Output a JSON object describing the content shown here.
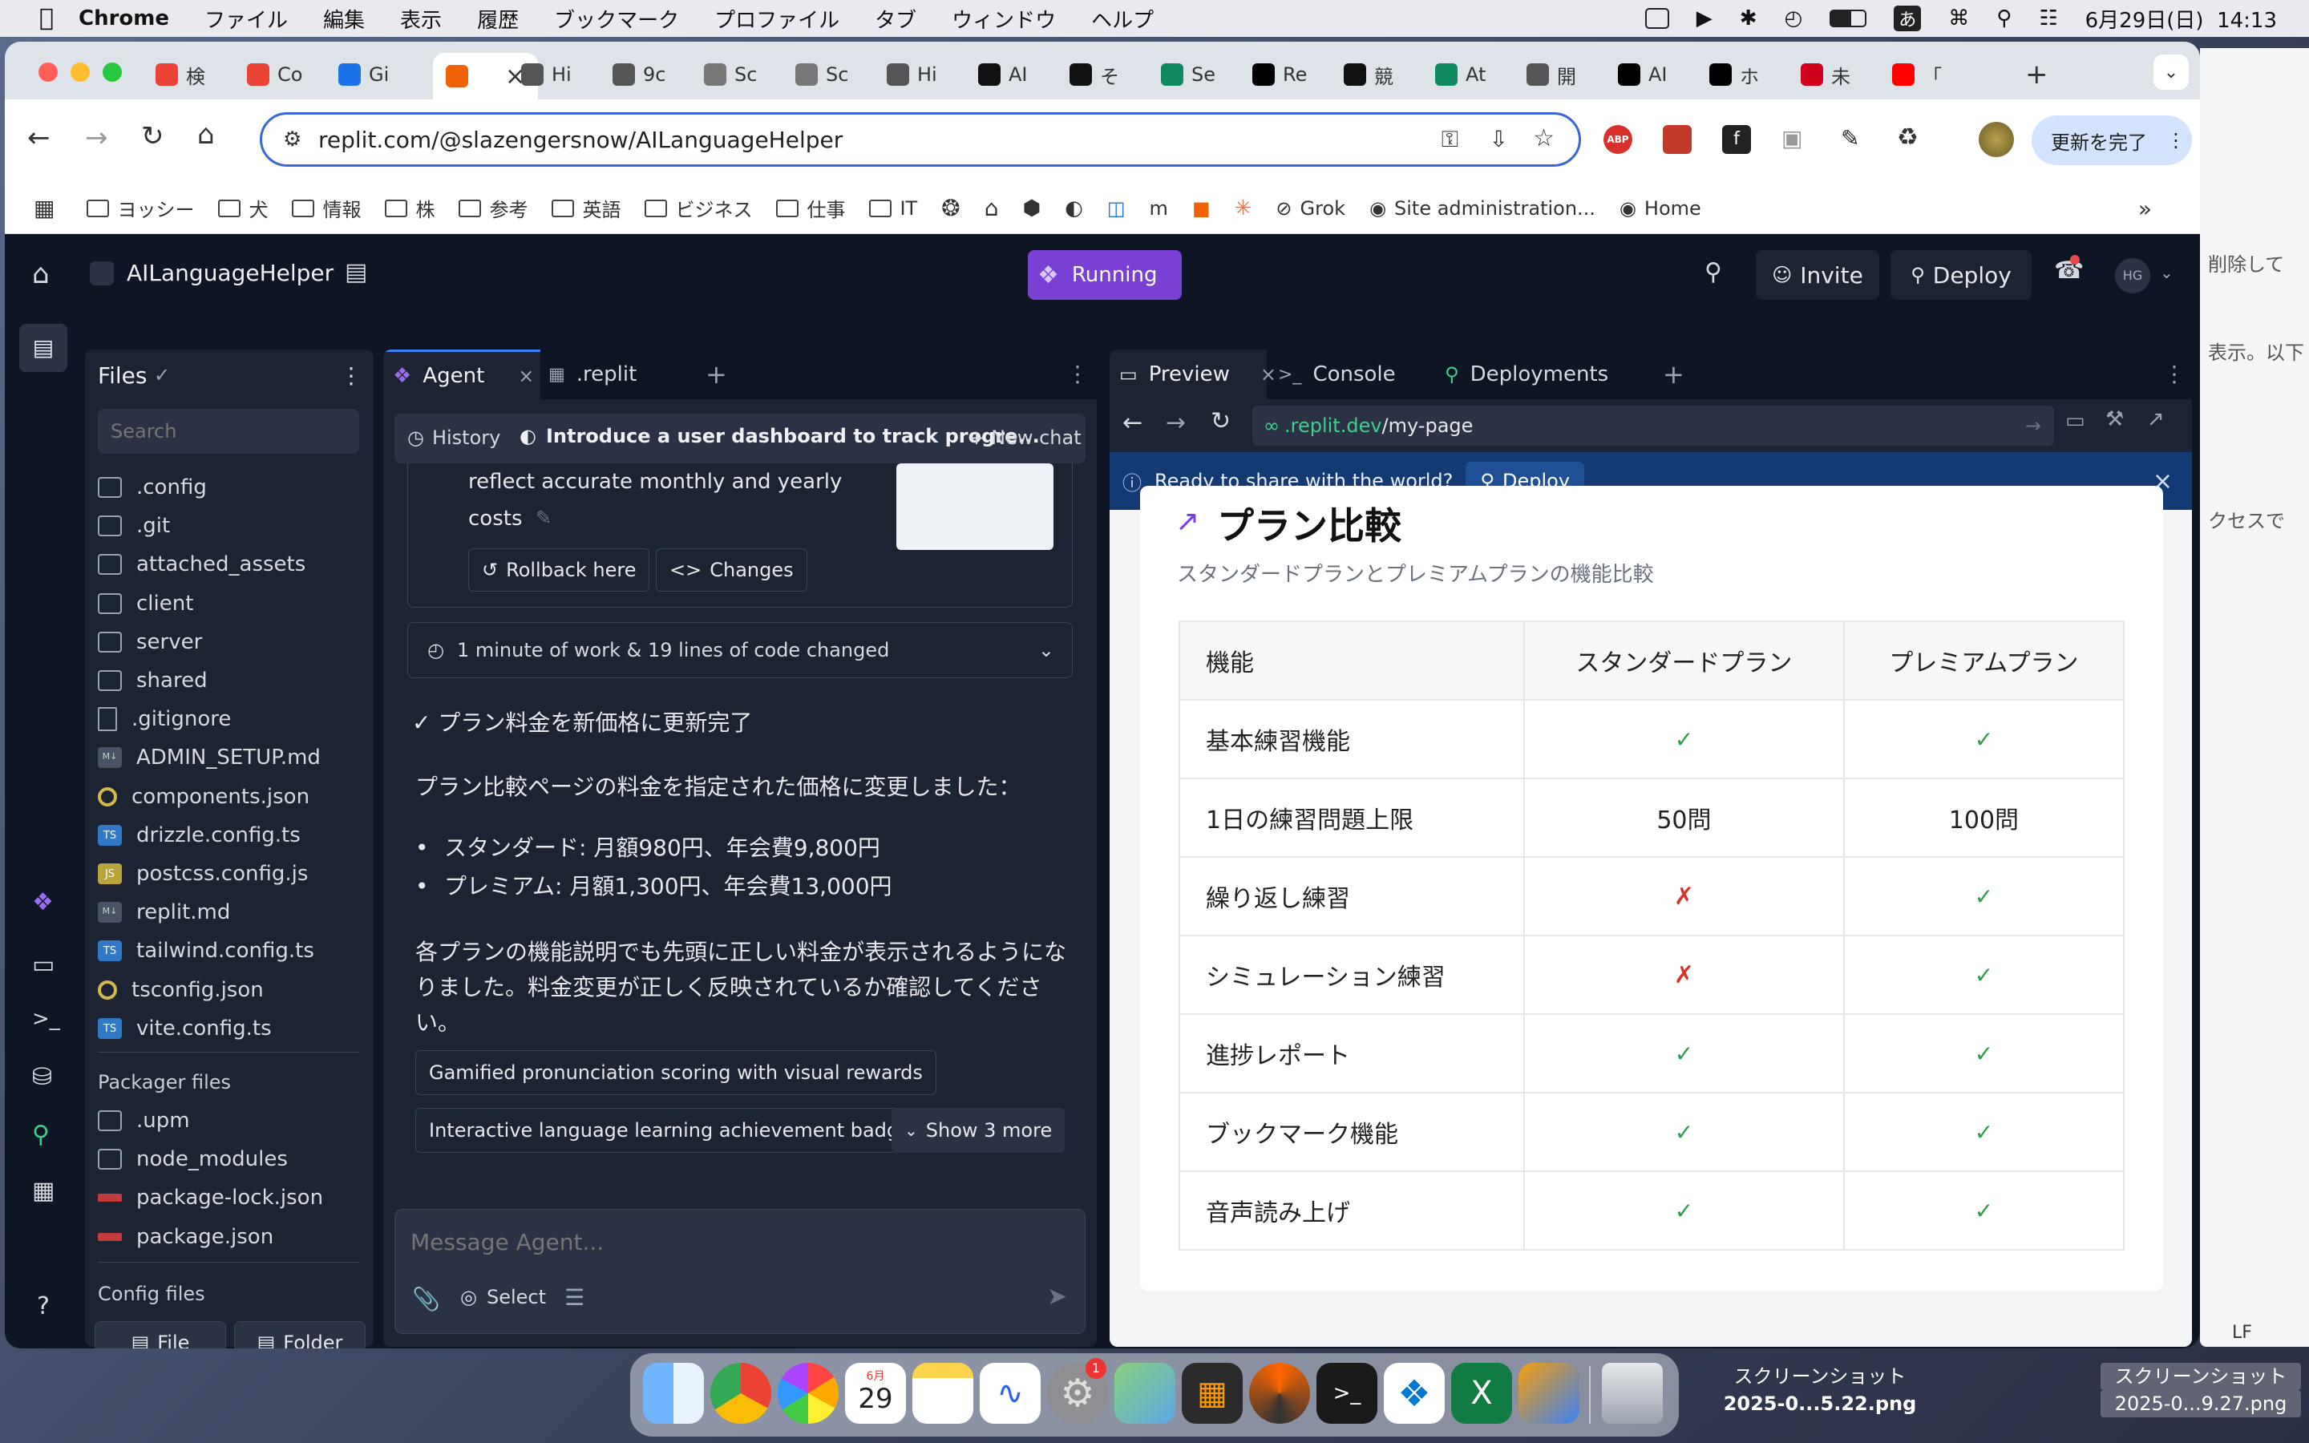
{
  "menubar": {
    "app": "Chrome",
    "items": [
      "ファイル",
      "編集",
      "表示",
      "履歴",
      "ブックマーク",
      "プロファイル",
      "タブ",
      "ウィンドウ",
      "ヘルプ"
    ],
    "ime": "あ",
    "datetime": "6月29日(日)  14:13"
  },
  "tabs": [
    {
      "label": "検",
      "color": "#ea4335"
    },
    {
      "label": "Co",
      "color": "#ea4335"
    },
    {
      "label": "Gi",
      "color": "#1a73e8"
    },
    {
      "label": "",
      "color": "#f26207"
    },
    {
      "label": "Hi",
      "color": "#555"
    },
    {
      "label": "9c",
      "color": "#555"
    },
    {
      "label": "Sc",
      "color": "#777"
    },
    {
      "label": "Sc",
      "color": "#777"
    },
    {
      "label": "Hi",
      "color": "#555"
    },
    {
      "label": "AI",
      "color": "#111"
    },
    {
      "label": "そ",
      "color": "#111"
    },
    {
      "label": "Se",
      "color": "#0f8a5f"
    },
    {
      "label": "Re",
      "color": "#000"
    },
    {
      "label": "競",
      "color": "#111"
    },
    {
      "label": "At",
      "color": "#0f8a5f"
    },
    {
      "label": "開",
      "color": "#555"
    },
    {
      "label": "AI",
      "color": "#000"
    },
    {
      "label": "ホ",
      "color": "#000"
    },
    {
      "label": "未",
      "color": "#d0021b"
    },
    {
      "label": "「",
      "color": "#ff0000"
    }
  ],
  "url": "replit.com/@slazengersnow/AILanguageHelper",
  "update_button": "更新を完了",
  "bookmarks": [
    "ヨッシー",
    "犬",
    "情報",
    "株",
    "参考",
    "英語",
    "ビジネス",
    "仕事",
    "IT"
  ],
  "bookmarks_extra": {
    "grok": "Grok",
    "site_admin": "Site administration...",
    "home": "Home"
  },
  "replit": {
    "project": "AILanguageHelper",
    "status": "Running",
    "invite": "Invite",
    "deploy": "Deploy",
    "avatar": "HG",
    "files_title": "Files",
    "search_placeholder": "Search",
    "files": [
      {
        "name": ".config",
        "kind": "folder"
      },
      {
        "name": ".git",
        "kind": "folder"
      },
      {
        "name": "attached_assets",
        "kind": "folder"
      },
      {
        "name": "client",
        "kind": "folder"
      },
      {
        "name": "server",
        "kind": "folder"
      },
      {
        "name": "shared",
        "kind": "folder"
      },
      {
        "name": ".gitignore",
        "kind": "file"
      },
      {
        "name": "ADMIN_SETUP.md",
        "kind": "md"
      },
      {
        "name": "components.json",
        "kind": "ring"
      },
      {
        "name": "drizzle.config.ts",
        "kind": "ts"
      },
      {
        "name": "postcss.config.js",
        "kind": "js"
      },
      {
        "name": "replit.md",
        "kind": "md"
      },
      {
        "name": "tailwind.config.ts",
        "kind": "ts"
      },
      {
        "name": "tsconfig.json",
        "kind": "ring"
      },
      {
        "name": "vite.config.ts",
        "kind": "ts"
      }
    ],
    "packager_title": "Packager files",
    "packager_files": [
      {
        "name": ".upm",
        "kind": "folder"
      },
      {
        "name": "node_modules",
        "kind": "folder"
      },
      {
        "name": "package-lock.json",
        "kind": "pkg"
      },
      {
        "name": "package.json",
        "kind": "pkg"
      }
    ],
    "config_title": "Config files",
    "new_file": "File",
    "new_folder": "Folder",
    "agent_tab": "Agent",
    "replit_tab": ".replit",
    "history": "History",
    "chat_title": "Introduce a user dashboard to track progre...",
    "new_chat": "New chat",
    "msg_line1": "reflect accurate monthly and yearly",
    "msg_line2": "costs",
    "rollback": "Rollback here",
    "changes": "Changes",
    "work_summary": "1 minute of work & 19 lines of code changed",
    "done_line": "✓ プラン料金を新価格に更新完了",
    "intro": "プラン比較ページの料金を指定された価格に変更しました：",
    "bullets": [
      "スタンダード: 月額980円、年会費9,800円",
      "プレミアム: 月額1,300円、年会費13,000円"
    ],
    "para": [
      "各プランの機能説明でも先頭に正しい料金が表示されるようにな",
      "りました。料金変更が正しく反映されているか確認してくださ",
      "い。"
    ],
    "suggestions": [
      "Gamified pronunciation scoring with visual rewards",
      "Interactive language learning achievement badges"
    ],
    "show_more": "Show 3 more",
    "message_placeholder": "Message Agent...",
    "select": "Select",
    "preview_tab": "Preview",
    "console_tab": "Console",
    "deployments_tab": "Deployments",
    "preview_url_host": ".replit.dev",
    "preview_url_path": "/my-page",
    "share_text": "Ready to share with the world?",
    "share_deploy": "Deploy",
    "page_title": "プラン比較",
    "page_subtitle": "スタンダードプランとプレミアムプランの機能比較",
    "table": {
      "headers": [
        "機能",
        "スタンダードプラン",
        "プレミアムプラン"
      ],
      "rows": [
        [
          "基本練習機能",
          "✓",
          "✓"
        ],
        [
          "1日の練習問題上限",
          "50問",
          "100問"
        ],
        [
          "繰り返し練習",
          "✗",
          "✓"
        ],
        [
          "シミュレーション練習",
          "✗",
          "✓"
        ],
        [
          "進捗レポート",
          "✓",
          "✓"
        ],
        [
          "ブックマーク機能",
          "✓",
          "✓"
        ],
        [
          "音声読み上げ",
          "✓",
          "✓"
        ]
      ]
    }
  },
  "bg_window_text": [
    "削除して",
    "表示。以下",
    "クセスで"
  ],
  "bg_status": {
    "lf": "LF"
  },
  "desktop_files": [
    {
      "line1": "スクリーンショット",
      "line2": "2025-0...5.22.png"
    },
    {
      "line1": "スクリーンショット",
      "line2": "2025-0...9.27.png"
    }
  ],
  "dock_badge": "1",
  "dock_calendar": {
    "month": "6月",
    "day": "29"
  }
}
